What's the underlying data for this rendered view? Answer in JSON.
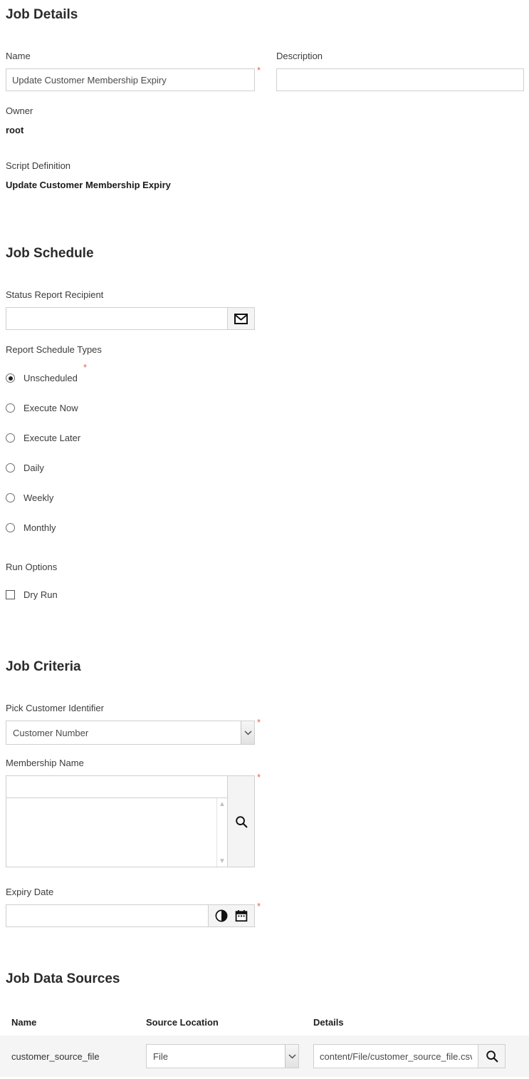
{
  "job_details": {
    "heading": "Job Details",
    "name_label": "Name",
    "name_value": "Update Customer Membership Expiry",
    "description_label": "Description",
    "description_value": "",
    "owner_label": "Owner",
    "owner_value": "root",
    "script_definition_label": "Script Definition",
    "script_definition_value": "Update Customer Membership Expiry",
    "required_marker": "*"
  },
  "job_schedule": {
    "heading": "Job Schedule",
    "recipient_label": "Status Report Recipient",
    "recipient_value": "",
    "recipient_icon": "envelope-icon",
    "schedule_types_label": "Report Schedule Types",
    "required_marker": "*",
    "schedule_options": [
      {
        "label": "Unscheduled",
        "selected": true
      },
      {
        "label": "Execute Now",
        "selected": false
      },
      {
        "label": "Execute Later",
        "selected": false
      },
      {
        "label": "Daily",
        "selected": false
      },
      {
        "label": "Weekly",
        "selected": false
      },
      {
        "label": "Monthly",
        "selected": false
      }
    ],
    "run_options_label": "Run Options",
    "dry_run_label": "Dry Run",
    "dry_run_checked": false
  },
  "job_criteria": {
    "heading": "Job Criteria",
    "pick_customer_label": "Pick Customer Identifier",
    "pick_customer_value": "Customer Number",
    "membership_name_label": "Membership Name",
    "membership_name_value": "",
    "membership_search_icon": "search-icon",
    "expiry_date_label": "Expiry Date",
    "expiry_date_value": "",
    "expiry_clock_icon": "clock-icon",
    "expiry_calendar_icon": "calendar-icon",
    "required_marker": "*"
  },
  "job_data_sources": {
    "heading": "Job Data Sources",
    "columns": [
      "Name",
      "Source Location",
      "Details"
    ],
    "rows": [
      {
        "name": "customer_source_file",
        "source_location": "File",
        "details": "content/File/customer_source_file.csv",
        "details_search_icon": "search-icon"
      }
    ]
  },
  "colors": {
    "required_star": "#e8604c",
    "border": "#cfcfcf",
    "row_background": "#f5f5f5",
    "heading": "#2b2b2b"
  }
}
